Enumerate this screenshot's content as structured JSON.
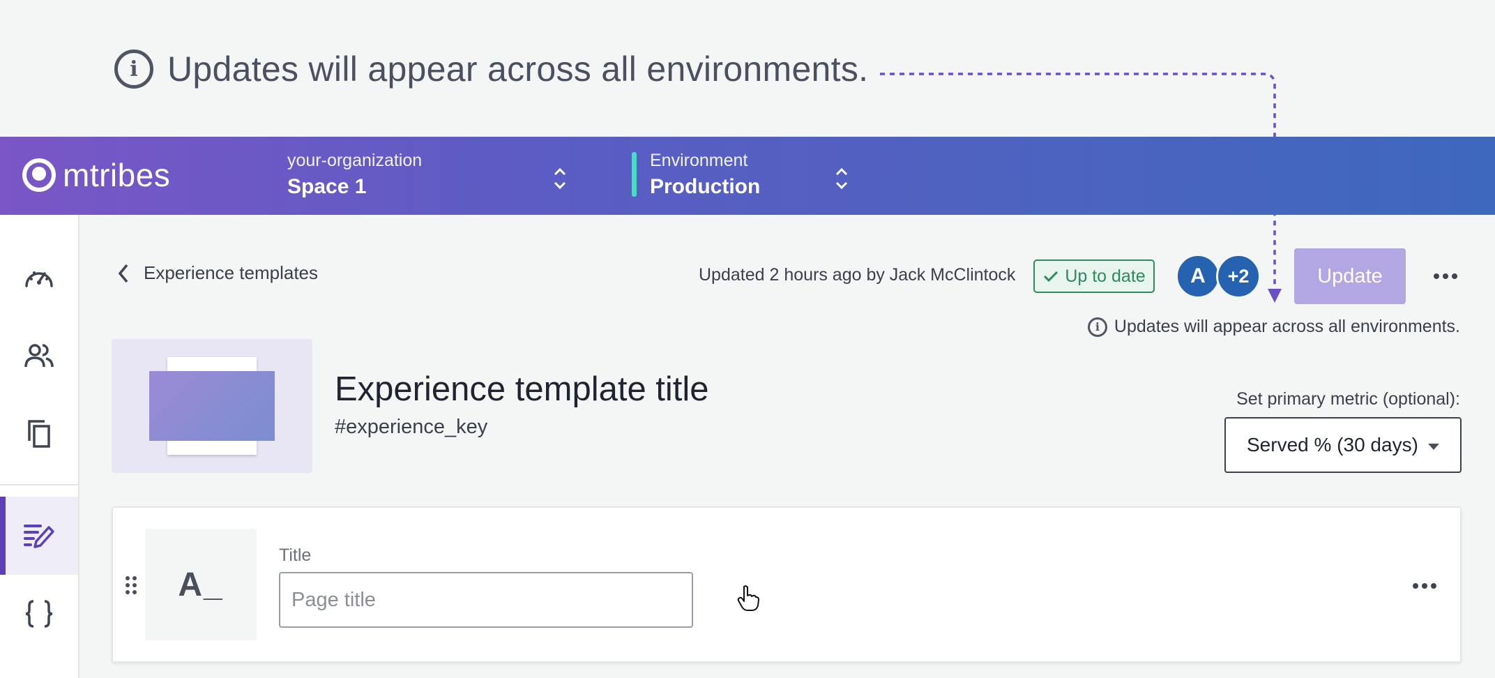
{
  "callout": {
    "text": "Updates will appear across all environments.",
    "icon": "info-icon"
  },
  "header": {
    "logo": "mtribes",
    "organization": {
      "label": "your-organization",
      "value": "Space 1"
    },
    "environment": {
      "label": "Environment",
      "value": "Production"
    },
    "colors": {
      "gradient_start": "#7a56c6",
      "gradient_end": "#3e68bd",
      "environment_accent": "#4ddbc9"
    }
  },
  "sidebar": {
    "items": [
      {
        "name": "dashboard-icon"
      },
      {
        "name": "users-icon"
      },
      {
        "name": "copy-icon"
      },
      {
        "name": "edit-template-icon",
        "active": true
      },
      {
        "name": "code-braces-icon"
      }
    ]
  },
  "toolbar": {
    "back_label": "Experience templates",
    "updated_text": "Updated 2 hours ago by Jack McClintock",
    "status_badge": "Up to date",
    "avatars": [
      "A",
      "+2"
    ],
    "update_label": "Update",
    "info_text": "Updates will appear across all environments."
  },
  "template": {
    "title": "Experience template title",
    "key": "#experience_key"
  },
  "metric": {
    "label": "Set primary metric (optional):",
    "selected": "Served % (30 days)"
  },
  "field": {
    "icon_glyph": "A_",
    "label": "Title",
    "placeholder": "Page title",
    "value": ""
  }
}
